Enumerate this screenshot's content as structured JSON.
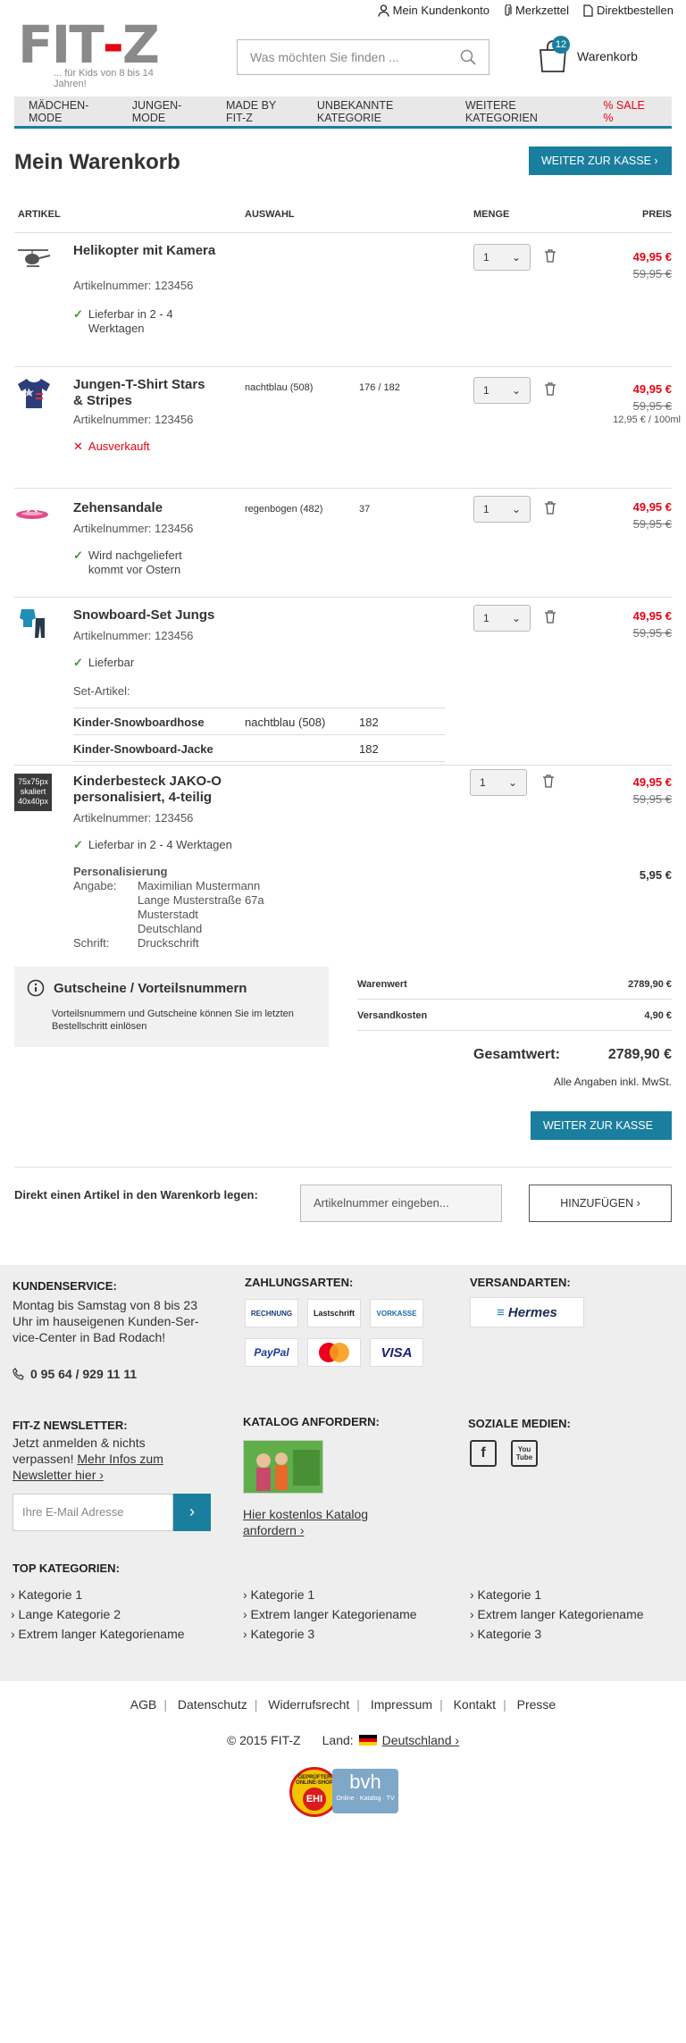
{
  "header": {
    "logo_text": "FIT-Z",
    "logo_tagline": "... für Kids von 8 bis 14 Jahren!",
    "links": [
      "Mein Kundenkonto",
      "Merkzettel",
      "Direktbestellen"
    ],
    "search_placeholder": "Was möchten Sie finden ...",
    "cart_count": "12",
    "cart_label": "Warenkorb"
  },
  "nav": [
    "MÄDCHEN-MODE",
    "JUNGEN-MODE",
    "MADE BY FIT-Z",
    "UNBEKANNTE KATEGORIE",
    "WEITERE KATEGORIEN",
    "% SALE %"
  ],
  "cart": {
    "title": "Mein Warenkorb",
    "checkout_label": "WEITER ZUR KASSE ›",
    "columns": {
      "artikel": "ARTIKEL",
      "auswahl": "AUSWAHL",
      "menge": "MENGE",
      "preis": "PREIS"
    },
    "items": [
      {
        "name": "Helikopter mit Kamera",
        "artnr": "Artikelnummer: 123456",
        "availability": "Lieferbar in 2 - 4 Werktagen",
        "qty": "1",
        "price": "49,95 €",
        "old_price": "59,95 €"
      },
      {
        "name": "Jungen-T-Shirt Stars & Stripes",
        "artnr": "Artikelnummer: 123456",
        "color": "nachtblau (508)",
        "size": "176 / 182",
        "availability": "Ausverkauft",
        "qty": "1",
        "price": "49,95 €",
        "old_price": "59,95 €",
        "unit_price": "12,95 € / 100ml"
      },
      {
        "name": "Zehensandale",
        "artnr": "Artikelnummer: 123456",
        "color": "regenbogen (482)",
        "size": "37",
        "availability": "Wird nachgeliefert kommt vor Ostern",
        "qty": "1",
        "price": "49,95 €",
        "old_price": "59,95 €"
      },
      {
        "name": "Snowboard-Set Jungs",
        "artnr": "Artikelnummer: 123456",
        "availability": "Lieferbar",
        "set_label": "Set-Artikel:",
        "qty": "1",
        "price": "49,95 €",
        "old_price": "59,95 €",
        "set_items": [
          {
            "name": "Kinder-Snowboardhose",
            "color": "nachtblau (508)",
            "size": "182"
          },
          {
            "name": "Kinder-Snowboard-Jacke",
            "color": "",
            "size": "182"
          }
        ]
      },
      {
        "name": "Kinderbesteck JAKO-O personalisiert, 4-teilig",
        "thumb_text": "75x75px skaliert 40x40px",
        "artnr": "Artikelnummer: 123456",
        "availability": "Lieferbar in 2 - 4 Werktagen",
        "qty": "1",
        "price": "49,95 €",
        "old_price": "59,95 €",
        "personalization": {
          "title": "Personalisierung",
          "angabe_label": "Angabe:",
          "angabe": [
            "Maximilian Mustermann",
            "Lange Musterstraße 67a",
            "Musterstadt",
            "Deutschland"
          ],
          "schrift_label": "Schrift:",
          "schrift": "Druckschrift",
          "price": "5,95 €"
        }
      }
    ],
    "voucher": {
      "title": "Gutscheine / Vorteilsnummern",
      "text": "Vorteilsnummern und Gutscheine können Sie im letzten Bestellschritt einlösen"
    },
    "summary": {
      "warenwert_label": "Warenwert",
      "warenwert": "2789,90 €",
      "versand_label": "Versandkosten",
      "versand": "4,90 €",
      "total_label": "Gesamtwert:",
      "total": "2789,90 €",
      "vat_note": "Alle Angaben inkl. MwSt."
    },
    "direct": {
      "label": "Direkt einen Artikel in den Warenkorb legen:",
      "placeholder": "Artikelnummer eingeben...",
      "button": "HINZUFÜGEN ›"
    }
  },
  "footer": {
    "service_title": "KUNDENSERVICE:",
    "service_text": "Montag bis Samstag von 8 bis 23 Uhr im hauseigenen Kunden-Ser-vice-Center in Bad Rodach!",
    "phone": "0 95 64 / 929 11 11",
    "payment_title": "ZAHLUNGSARTEN:",
    "payments": [
      "RECHNUNG",
      "Lastschrift",
      "VORKASSE",
      "PayPal",
      "MasterCard",
      "VISA"
    ],
    "shipping_title": "VERSANDARTEN:",
    "shipping": "Hermes",
    "newsletter_title": "FIT-Z NEWSLETTER:",
    "newsletter_text": "Jetzt anmelden & nichts verpassen!",
    "newsletter_link": "Mehr Infos zum Newsletter hier ›",
    "newsletter_placeholder": "Ihre E-Mail Adresse",
    "newsletter_submit": "›",
    "catalog_title": "KATALOG ANFORDERN:",
    "catalog_link": "Hier kostenlos Katalog anfordern ›",
    "social_title": "SOZIALE MEDIEN:",
    "social": [
      "f",
      "You Tube"
    ],
    "top_title": "TOP KATEGORIEN:",
    "top_cols": [
      [
        "› Kategorie 1",
        "› Lange Kategorie 2",
        "› Extrem langer Kategoriename"
      ],
      [
        "› Kategorie 1",
        "› Extrem langer Kategoriename",
        "› Kategorie 3"
      ],
      [
        "› Kategorie 1",
        "› Extrem langer Kategoriename",
        "› Kategorie 3"
      ]
    ]
  },
  "bottom": {
    "links": [
      "AGB",
      "Datenschutz",
      "Widerrufsrecht",
      "Impressum",
      "Kontakt",
      "Presse"
    ],
    "copyright": "© 2015 FIT-Z",
    "land_label": "Land:",
    "land": "Deutschland ›",
    "seal1": "GEPRÜFTER ONLINE-SHOP",
    "seal1_center": "EHI",
    "seal2": "bvh",
    "seal2_sub": "Online · Katalog · TV"
  },
  "colors": {
    "accent": "#1a7f9e",
    "sale": "#e30613",
    "available": "#3c9a2f"
  }
}
